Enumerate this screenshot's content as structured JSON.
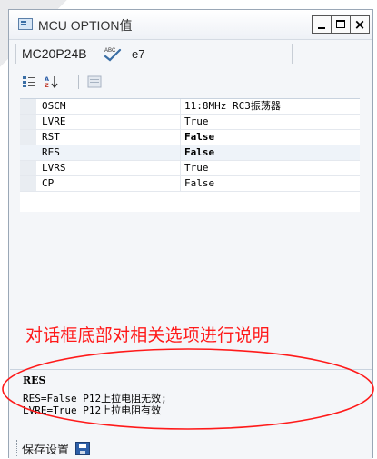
{
  "window": {
    "title": "MCU OPTION值",
    "buttons": {
      "minimize": "_",
      "maximize": "□",
      "close": "×"
    }
  },
  "device": {
    "name": "MC20P24B",
    "spell_icon": "abc-spellcheck-icon",
    "code": "e7"
  },
  "toolbar": {
    "icons": [
      "categorized-icon",
      "sort-alphabetical-icon",
      "property-pages-icon"
    ]
  },
  "options": [
    {
      "name": "OSCM",
      "value": "11:8MHz RC3振荡器",
      "bold": false
    },
    {
      "name": "LVRE",
      "value": "True",
      "bold": false
    },
    {
      "name": "RST",
      "value": "False",
      "bold": true
    },
    {
      "name": "RES",
      "value": "False",
      "bold": true
    },
    {
      "name": "LVRS",
      "value": "True",
      "bold": false
    },
    {
      "name": "CP",
      "value": "False",
      "bold": false
    }
  ],
  "annotation": {
    "text": "对话框底部对相关选项进行说明",
    "color": "#ff1a1a"
  },
  "description": {
    "title": "RES",
    "lines": [
      "RES=False P12上拉电阻无效;",
      "LVRE=True P12上拉电阻有效"
    ]
  },
  "status": {
    "save_label": "保存设置",
    "save_icon": "floppy-disk-icon"
  },
  "colors": {
    "window_bg": "#f4f6f9",
    "border": "#9aa7b6",
    "annotation_red": "#ff1a1a"
  }
}
